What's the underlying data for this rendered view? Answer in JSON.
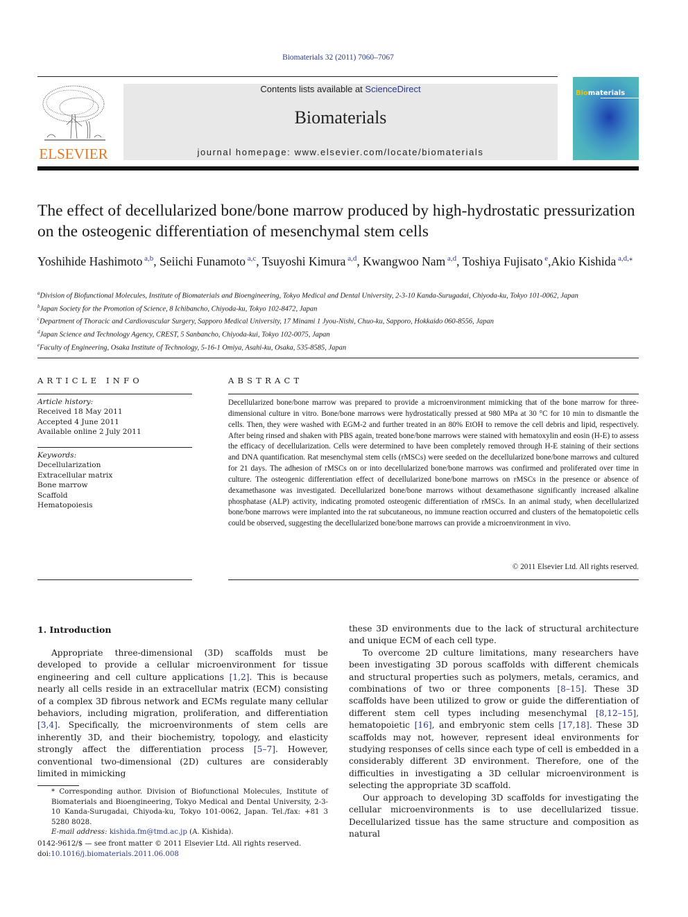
{
  "header": {
    "citation": "Biomaterials 32 (2011) 7060–7067",
    "publisher_logo_text": "ELSEVIER",
    "contents_prefix": "Contents lists available at ",
    "contents_link": "ScienceDirect",
    "journal_name": "Biomaterials",
    "homepage": "journal homepage: www.elsevier.com/locate/biomaterials",
    "cover_title_bi": "Bio",
    "cover_title_rest": "materials",
    "colors": {
      "link": "#2b3a8c",
      "elsevier_orange": "#e87722",
      "masthead_bg": "#e8e8e8"
    }
  },
  "article": {
    "title": "The effect of decellularized bone/bone marrow produced by high-hydrostatic pressurization on the osteogenic differentiation of mesenchymal stem cells",
    "authors": [
      {
        "name": "Yoshihide Hashimoto",
        "sup": "a,b",
        "sep": ", "
      },
      {
        "name": "Seiichi Funamoto",
        "sup": "a,c",
        "sep": ", "
      },
      {
        "name": "Tsuyoshi Kimura",
        "sup": "a,d",
        "sep": ", "
      },
      {
        "name": "Kwangwoo Nam",
        "sup": "a,d",
        "sep": ", "
      },
      {
        "name": "Toshiya Fujisato",
        "sup": "e",
        "sep": ","
      },
      {
        "name": "Akio Kishida",
        "sup": "a,d,⁎",
        "sep": ""
      }
    ],
    "affiliations": [
      {
        "key": "a",
        "text": "Division of Biofunctional Molecules, Institute of Biomaterials and Bioengineering, Tokyo Medical and Dental University, 2-3-10 Kanda-Surugadai, Chiyoda-ku, Tokyo 101-0062, Japan"
      },
      {
        "key": "b",
        "text": "Japan Society for the Promotion of Science, 8 Ichibancho, Chiyoda-ku, Tokyo 102-8472, Japan"
      },
      {
        "key": "c",
        "text": "Department of Thoracic and Cardiovascular Surgery, Sapporo Medical University, 17 Minami 1 Jyou-Nishi, Chuo-ku, Sapporo, Hokkaido 060-8556, Japan"
      },
      {
        "key": "d",
        "text": "Japan Science and Technology Agency, CREST, 5 Sanbancho, Chiyoda-kui, Tokyo 102-0075, Japan"
      },
      {
        "key": "e",
        "text": "Faculty of Engineering, Osaka Institute of Technology, 5-16-1 Omiya, Asahi-ku, Osaka, 535-8585, Japan"
      }
    ]
  },
  "article_info": {
    "heading": "ARTICLE INFO",
    "history_label": "Article history:",
    "history": [
      "Received 18 May 2011",
      "Accepted 4 June 2011",
      "Available online 2 July 2011"
    ],
    "keywords_label": "Keywords:",
    "keywords": [
      "Decellularization",
      "Extracellular matrix",
      "Bone marrow",
      "Scaffold",
      "Hematopoiesis"
    ]
  },
  "abstract": {
    "heading": "ABSTRACT",
    "text": "Decellularized bone/bone marrow was prepared to provide a microenvironment mimicking that of the bone marrow for three-dimensional culture in vitro. Bone/bone marrows were hydrostatically pressed at 980 MPa at 30 °C for 10 min to dismantle the cells. Then, they were washed with EGM-2 and further treated in an 80% EtOH to remove the cell debris and lipid, respectively. After being rinsed and shaken with PBS again, treated bone/bone marrows were stained with hematoxylin and eosin (H-E) to assess the efficacy of decellularization. Cells were determined to have been completely removed through H-E staining of their sections and DNA quantification. Rat mesenchymal stem cells (rMSCs) were seeded on the decellularized bone/bone marrows and cultured for 21 days. The adhesion of rMSCs on or into decellularized bone/bone marrows was confirmed and proliferated over time in culture. The osteogenic differentiation effect of decellularized bone/bone marrows on rMSCs in the presence or absence of dexamethasone was investigated. Decellularized bone/bone marrows without dexamethasone significantly increased alkaline phosphatase (ALP) activity, indicating promoted osteogenic differentiation of rMSCs. In an animal study, when decellularized bone/bone marrows were implanted into the rat subcutaneous, no immune reaction occurred and clusters of the hematopoietic cells could be observed, suggesting the decellularized bone/bone marrows can provide a microenvironment in vivo.",
    "copyright": "© 2011 Elsevier Ltd. All rights reserved."
  },
  "introduction": {
    "heading": "1.  Introduction",
    "p1": [
      {
        "t": "Appropriate three-dimensional (3D) scaffolds must be developed to provide a cellular microenvironment for tissue engineering and cell culture applications "
      },
      {
        "ref": "[1,2]"
      },
      {
        "t": ". This is because nearly all cells reside in an extracellular matrix (ECM) consisting of a complex 3D fibrous network and ECMs regulate many cellular behaviors, including migration, proliferation, and differentiation "
      },
      {
        "ref": "[3,4]"
      },
      {
        "t": ". Specifically, the microenvironments of stem cells are inherently 3D, and their biochemistry, topology, and elasticity strongly affect the differentiation process "
      },
      {
        "ref": "[5–7]"
      },
      {
        "t": ". However, conventional two-dimensional (2D) cultures are considerably limited in mimicking"
      }
    ],
    "p1_cont": "these 3D environments due to the lack of structural architecture and unique ECM of each cell type.",
    "p2": [
      {
        "t": "To overcome 2D culture limitations, many researchers have been investigating 3D porous scaffolds with different chemicals and structural properties such as polymers, metals, ceramics, and combinations of two or three components "
      },
      {
        "ref": "[8–15]"
      },
      {
        "t": ". These 3D scaffolds have been utilized to grow or guide the differentiation of different stem cell types including mesenchymal "
      },
      {
        "ref": "[8,12–15]"
      },
      {
        "t": ", hematopoietic "
      },
      {
        "ref": "[16]"
      },
      {
        "t": ", and embryonic stem cells "
      },
      {
        "ref": "[17,18]"
      },
      {
        "t": ". These 3D scaffolds may not, however, represent ideal environments for studying responses of cells since each type of cell is embedded in a considerably different 3D environment. Therefore, one of the difficulties in investigating a 3D cellular microenvironment is selecting the appropriate 3D scaffold."
      }
    ],
    "p3": "Our approach to developing 3D scaffolds for investigating the cellular microenvironments is to use decellularized tissue. Decellularized tissue has the same structure and composition as natural"
  },
  "footnote": {
    "corresponding": "* Corresponding author. Division of Biofunctional Molecules, Institute of Biomaterials and Bioengineering, Tokyo Medical and Dental University, 2-3-10 Kanda-Surugadai, Chiyoda-ku, Tokyo 101-0062, Japan. Tel./fax: +81 3 5280 8028.",
    "email_label": "E-mail address:",
    "email": "kishida.fm@tmd.ac.jp",
    "email_suffix": " (A. Kishida).",
    "issn_line": "0142-9612/$ — see front matter © 2011 Elsevier Ltd. All rights reserved.",
    "doi_prefix": "doi:",
    "doi": "10.1016/j.biomaterials.2011.06.008"
  }
}
